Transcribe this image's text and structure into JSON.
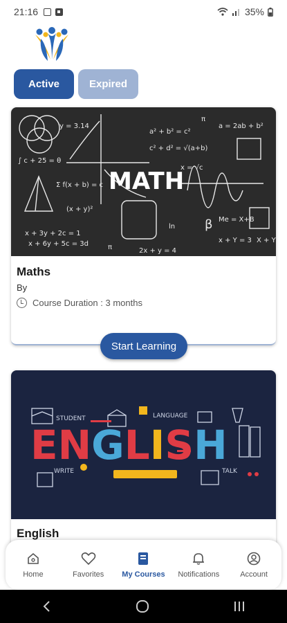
{
  "status_bar": {
    "time": "21:16",
    "battery": "35%"
  },
  "tabs": {
    "active": "Active",
    "expired": "Expired"
  },
  "courses": [
    {
      "title": "Maths",
      "image_text": "MATH",
      "by_label": "By",
      "duration": "Course Duration : 3 months",
      "cta": "Start Learning"
    },
    {
      "title": "English",
      "image_text": "ENGLISH",
      "image_labels": [
        "STUDENT",
        "LANGUAGE",
        "WRITE",
        "TALK"
      ]
    }
  ],
  "bottom_nav": [
    {
      "label": "Home",
      "icon": "home-icon"
    },
    {
      "label": "Favorites",
      "icon": "heart-icon"
    },
    {
      "label": "My Courses",
      "icon": "book-icon"
    },
    {
      "label": "Notifications",
      "icon": "bell-icon"
    },
    {
      "label": "Account",
      "icon": "account-icon"
    }
  ],
  "colors": {
    "primary": "#2a58a0",
    "tab_inactive": "#9fb3d4",
    "logo_blue": "#2a68b8",
    "logo_yellow": "#f2b61d"
  }
}
